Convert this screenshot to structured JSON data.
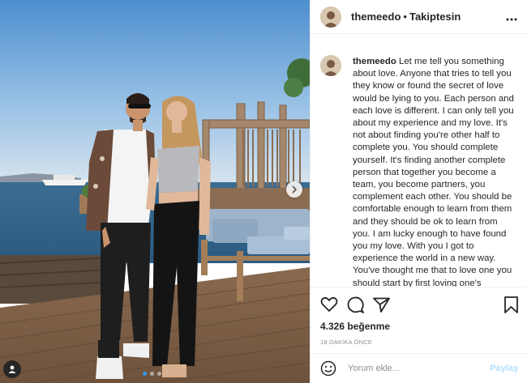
{
  "post": {
    "username": "themeedo",
    "follow_status": "Takiptesin",
    "bullet": "•",
    "more_icon": "more-horizontal-icon",
    "caption": "Let me tell you something about love. Anyone that tries to tell you they know or found the secret of love would be lying to you. Each person and each love is different. I can only tell you about my experience and my love. It's not about finding you're other half to complete you. You should complete yourself. It's finding another complete person that together you become a team, you become partners, you complement each other. You should be comfortable enough to learn from them and they should be ok to learn from you. I am lucky enough to have found you my love. With you I got to experience the world in a new way. You've thought me that to love one you should start by first loving one's",
    "likes": "4.326 beğenme",
    "time_ago": "18 DAKİKA ÖNCE"
  },
  "comment": {
    "placeholder": "Yorum ekle...",
    "post_label": "Paylaş"
  },
  "carousel": {
    "slide_count": 3,
    "active_index": 0
  },
  "colors": {
    "accent": "#3897f0",
    "post_disabled": "#b2dffc",
    "text": "#262626",
    "muted": "#8e8e8e"
  }
}
